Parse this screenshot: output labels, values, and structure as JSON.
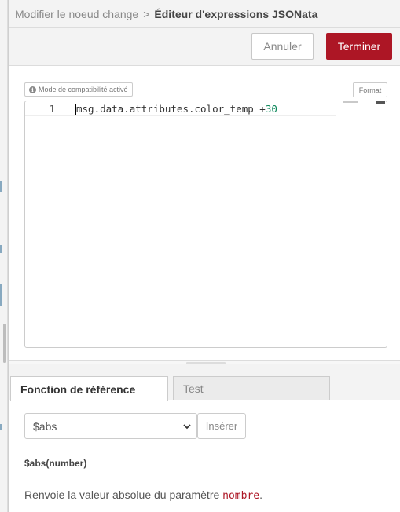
{
  "breadcrumb": {
    "parent": "Modifier le noeud change",
    "separator": ">",
    "current": "Éditeur d'expressions JSONata"
  },
  "toolbar": {
    "cancel_label": "Annuler",
    "done_label": "Terminer"
  },
  "editor": {
    "compat_badge": "Mode de compatibilité activé",
    "format_label": "Format",
    "lines": [
      {
        "number": "1",
        "text": "msg.data.attributes.color_temp +",
        "number_literal": "30"
      }
    ]
  },
  "tabs": [
    {
      "label": "Fonction de référence",
      "active": true
    },
    {
      "label": "Test",
      "active": false
    }
  ],
  "reference": {
    "selected_function": "$abs",
    "insert_label": "Insérer",
    "signature": "$abs(number)",
    "description_prefix": "Renvoie la valeur absolue du paramètre",
    "description_param": "nombre",
    "description_suffix": "."
  },
  "colors": {
    "primary": "#ad1625",
    "number_literal": "#098658"
  }
}
